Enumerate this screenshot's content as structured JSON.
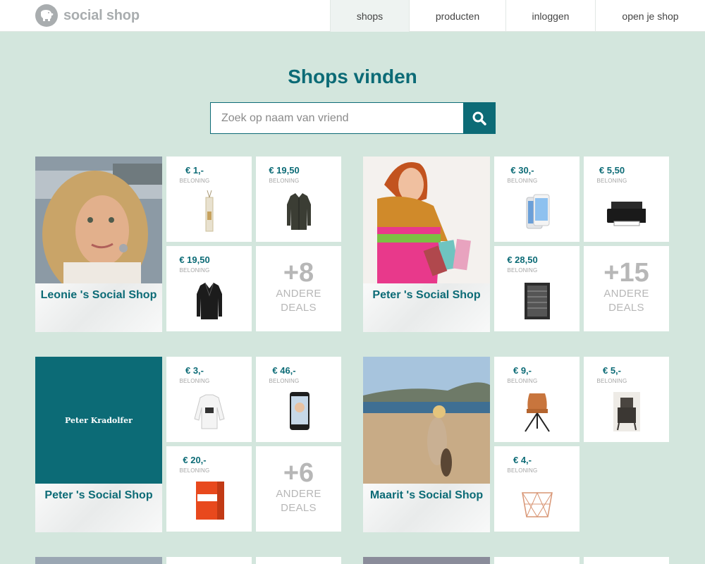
{
  "brand": {
    "name": "social shop"
  },
  "nav": [
    {
      "label": "shops"
    },
    {
      "label": "producten"
    },
    {
      "label": "inloggen"
    },
    {
      "label": "open je shop"
    }
  ],
  "page": {
    "title": "Shops vinden"
  },
  "search": {
    "placeholder": "Zoek op naam van vriend",
    "value": ""
  },
  "colors": {
    "accent": "#0c6b76",
    "background": "#d3e6dd"
  },
  "shops": [
    {
      "name": "Leonie 's Social Shop",
      "deals": [
        {
          "price": "€ 1,-",
          "label": "BELONING",
          "icon": "reed-diffuser-icon"
        },
        {
          "price": "€ 19,50",
          "label": "BELONING",
          "icon": "leather-jacket-icon"
        },
        {
          "price": "€ 19,50",
          "label": "BELONING",
          "icon": "biker-jacket-icon"
        }
      ],
      "more": {
        "count": "+8",
        "line1": "ANDERE",
        "line2": "DEALS"
      }
    },
    {
      "name": "Peter 's Social Shop",
      "deals": [
        {
          "price": "€ 30,-",
          "label": "BELONING",
          "icon": "smartphone-icon"
        },
        {
          "price": "€ 5,50",
          "label": "BELONING",
          "icon": "printer-icon"
        },
        {
          "price": "€ 28,50",
          "label": "BELONING",
          "icon": "wine-cooler-icon"
        }
      ],
      "more": {
        "count": "+15",
        "line1": "ANDERE",
        "line2": "DEALS"
      }
    },
    {
      "name": "Peter 's Social Shop",
      "avatar_text": "Peter Kradolfer",
      "deals": [
        {
          "price": "€ 3,-",
          "label": "BELONING",
          "icon": "sweater-icon"
        },
        {
          "price": "€ 46,-",
          "label": "BELONING",
          "icon": "phone-icon"
        },
        {
          "price": "€ 20,-",
          "label": "BELONING",
          "icon": "software-box-icon"
        }
      ],
      "more": {
        "count": "+6",
        "line1": "ANDERE",
        "line2": "DEALS"
      }
    },
    {
      "name": "Maarit 's Social Shop",
      "deals": [
        {
          "price": "€ 9,-",
          "label": "BELONING",
          "icon": "chair-icon"
        },
        {
          "price": "€ 5,-",
          "label": "BELONING",
          "icon": "stove-icon"
        },
        {
          "price": "€ 4,-",
          "label": "BELONING",
          "icon": "wire-basket-icon"
        }
      ]
    }
  ]
}
